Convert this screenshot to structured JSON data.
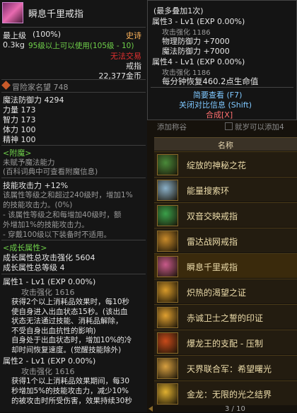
{
  "item": {
    "name": "瞬息千里戒指",
    "level_label": "最上级",
    "level_pct": "(100%)",
    "rarity": "史诗",
    "weight": "0.3kg",
    "use_req": "95级以上可以使用(105级 - 10)",
    "trade": "无法交易",
    "type": "戒指",
    "price": "22,377金币",
    "adventurer_fame": "冒险家名望 748",
    "stats": [
      "魔法防御力 4294",
      "力量 173",
      "智力 173",
      "体力 100",
      "精神 100"
    ],
    "enchant_title": "<附魔>",
    "enchant_lines": [
      "未赋予魔法能力",
      "(百科词典中可查看附魔信息)"
    ],
    "skill_atk": "技能攻击力 +12%",
    "skill_lines": [
      "该属性等级之和超过240级时，增加1%",
      "的技能攻击力。(0%)",
      "- 该属性等级之和每增加40级时，额",
      "外增加1%的技能攻击力。",
      "- 穿戴100级以下装备时不适用。"
    ],
    "growth_title": "<成长属性>",
    "growth_lines": [
      "成长属性总攻击强化 5604",
      "成长属性总等级 4"
    ],
    "attr1_title": "属性1 - Lv1 (EXP 0.00%)",
    "attr1_atk": "攻击强化 1616",
    "attr1_lines": [
      "获得2个以上消耗品效果时，每10秒",
      "使自身进入出血状态15秒。(该出血",
      "状态无法通过技能、消耗品解除，",
      "不受自身出血抗性的影响)",
      "自身处于出血状态时，增加10%的冷",
      "却时间恢复速度。(觉醒技能除外)"
    ],
    "attr2_title": "属性2 - Lv1 (EXP 0.00%)",
    "attr2_atk": "攻击强化 1616",
    "attr2_lines": [
      "获得1个以上消耗品效果期间，每30",
      "秒增加5%的技能攻击力，减少10%",
      "的被攻击时所受伤害，效果持续30秒"
    ]
  },
  "compare": {
    "header": "(最多叠加1次)",
    "attr3_title": "属性3 - Lv1 (EXP 0.00%)",
    "attr3_atk": "攻击强化 1186",
    "attr3_lines": [
      "物理防御力 +7000",
      "魔法防御力 +7000"
    ],
    "attr4_title": "属性4 - Lv1 (EXP 0.00%)",
    "attr4_atk": "攻击强化 1186",
    "attr4_line": "每分钟恢复460.2点生命值",
    "brief": "简要查看 (F7)",
    "close_compare": "关闭对比信息 (Shift)",
    "synth": "合成[X]"
  },
  "list": {
    "filter_left": "添加称谷",
    "filter_right": "就岁可以添加4",
    "header": "名称",
    "items": [
      {
        "label": "绽放的神秘之花",
        "color": "#4a8a3a"
      },
      {
        "label": "能量搜索环",
        "color": "#8ab0c8"
      },
      {
        "label": "双音交映戒指",
        "color": "#3aa04a"
      },
      {
        "label": "雷达战网戒指",
        "color": "#c88a2a"
      },
      {
        "label": "瞬息千里戒指",
        "color": "#c85a8a"
      },
      {
        "label": "炽热的渴望之证",
        "color": "#d89a2a"
      },
      {
        "label": "赤诚卫士之誓的印证",
        "color": "#e0a030"
      },
      {
        "label": "爆龙王的支配 - 压制",
        "color": "#c84a1a"
      },
      {
        "label": "天界联合军：希望曙光",
        "color": "#d8a040"
      },
      {
        "label": "金龙：无限的光之结界",
        "color": "#e0b030"
      }
    ],
    "pager": "3 / 10"
  }
}
